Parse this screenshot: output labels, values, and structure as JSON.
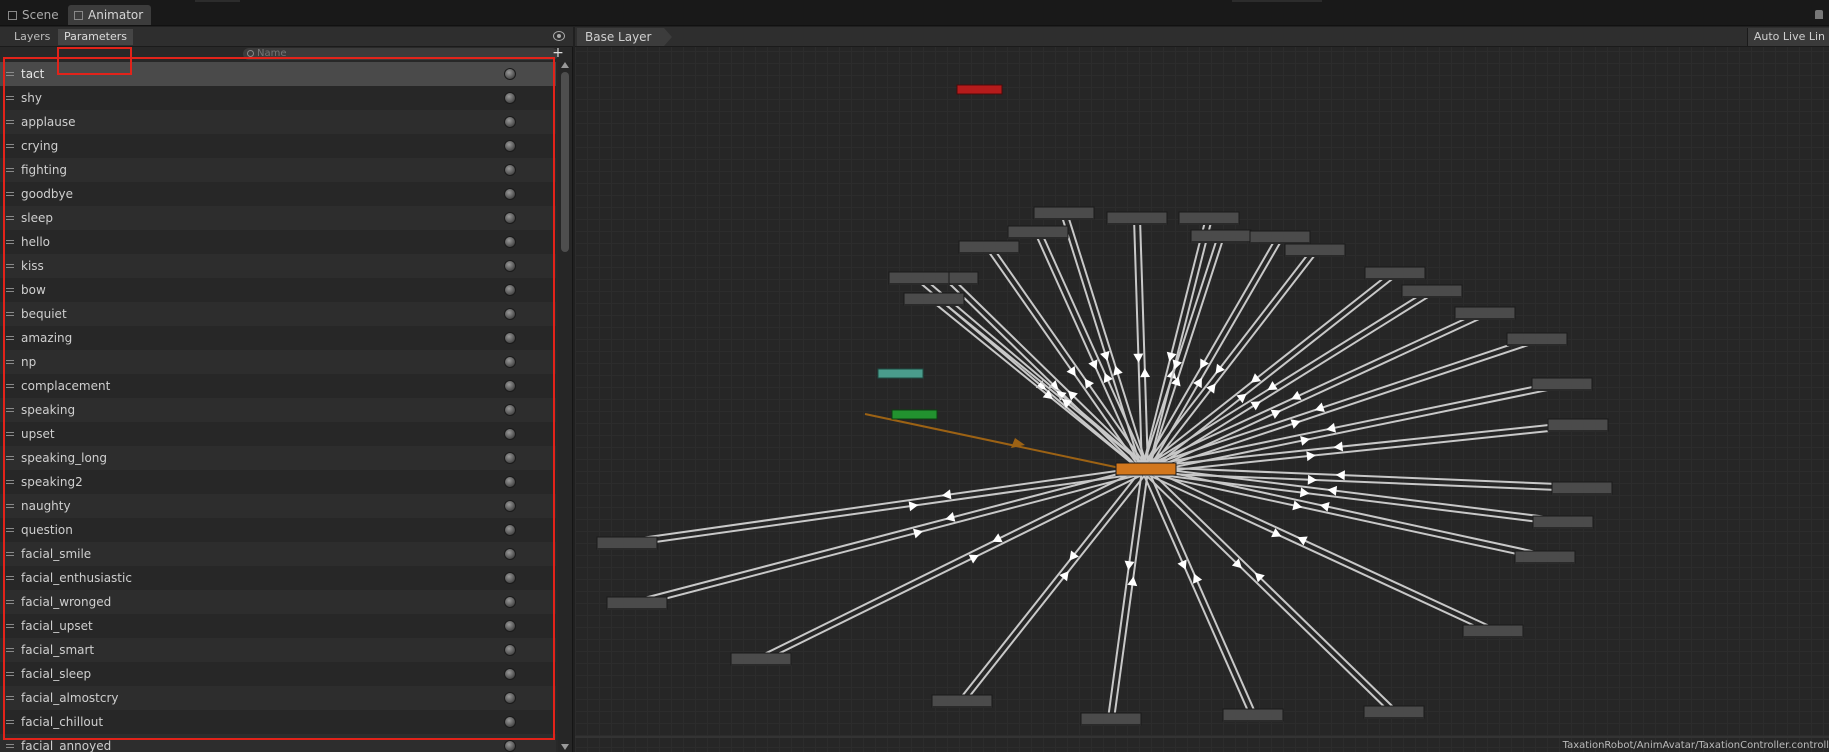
{
  "window": {
    "tabs": [
      {
        "label": "Scene"
      },
      {
        "label": "Animator"
      }
    ]
  },
  "left_panel": {
    "tabs": [
      {
        "label": "Layers"
      },
      {
        "label": "Parameters"
      }
    ],
    "search": {
      "placeholder": "Name"
    },
    "add_label": "+",
    "parameters": [
      {
        "label": "tact"
      },
      {
        "label": "shy"
      },
      {
        "label": "applause"
      },
      {
        "label": "crying"
      },
      {
        "label": "fighting"
      },
      {
        "label": "goodbye"
      },
      {
        "label": "sleep"
      },
      {
        "label": "hello"
      },
      {
        "label": "kiss"
      },
      {
        "label": "bow"
      },
      {
        "label": "bequiet"
      },
      {
        "label": "amazing"
      },
      {
        "label": "np"
      },
      {
        "label": "complacement"
      },
      {
        "label": "speaking"
      },
      {
        "label": "upset"
      },
      {
        "label": "speaking_long"
      },
      {
        "label": "speaking2"
      },
      {
        "label": "naughty"
      },
      {
        "label": "question"
      },
      {
        "label": "facial_smile"
      },
      {
        "label": "facial_enthusiastic"
      },
      {
        "label": "facial_wronged"
      },
      {
        "label": "facial_upset"
      },
      {
        "label": "facial_smart"
      },
      {
        "label": "facial_sleep"
      },
      {
        "label": "facial_almostcry"
      },
      {
        "label": "facial_chillout"
      },
      {
        "label": "facial_annoyed"
      }
    ]
  },
  "graph": {
    "breadcrumb": "Base Layer",
    "auto_live_label": "Auto Live Lin",
    "footer_path": "TaxationRobot/AnimAvatar/TaxationController.controll",
    "colors": {
      "hub": "#d2771d",
      "entry": "#22922f",
      "any_state": "#4a9c8c",
      "exit": "#b51b1b",
      "state": "#4b4b4b",
      "transition": "#c8c8c8",
      "default_transition": "#9c6214"
    }
  }
}
